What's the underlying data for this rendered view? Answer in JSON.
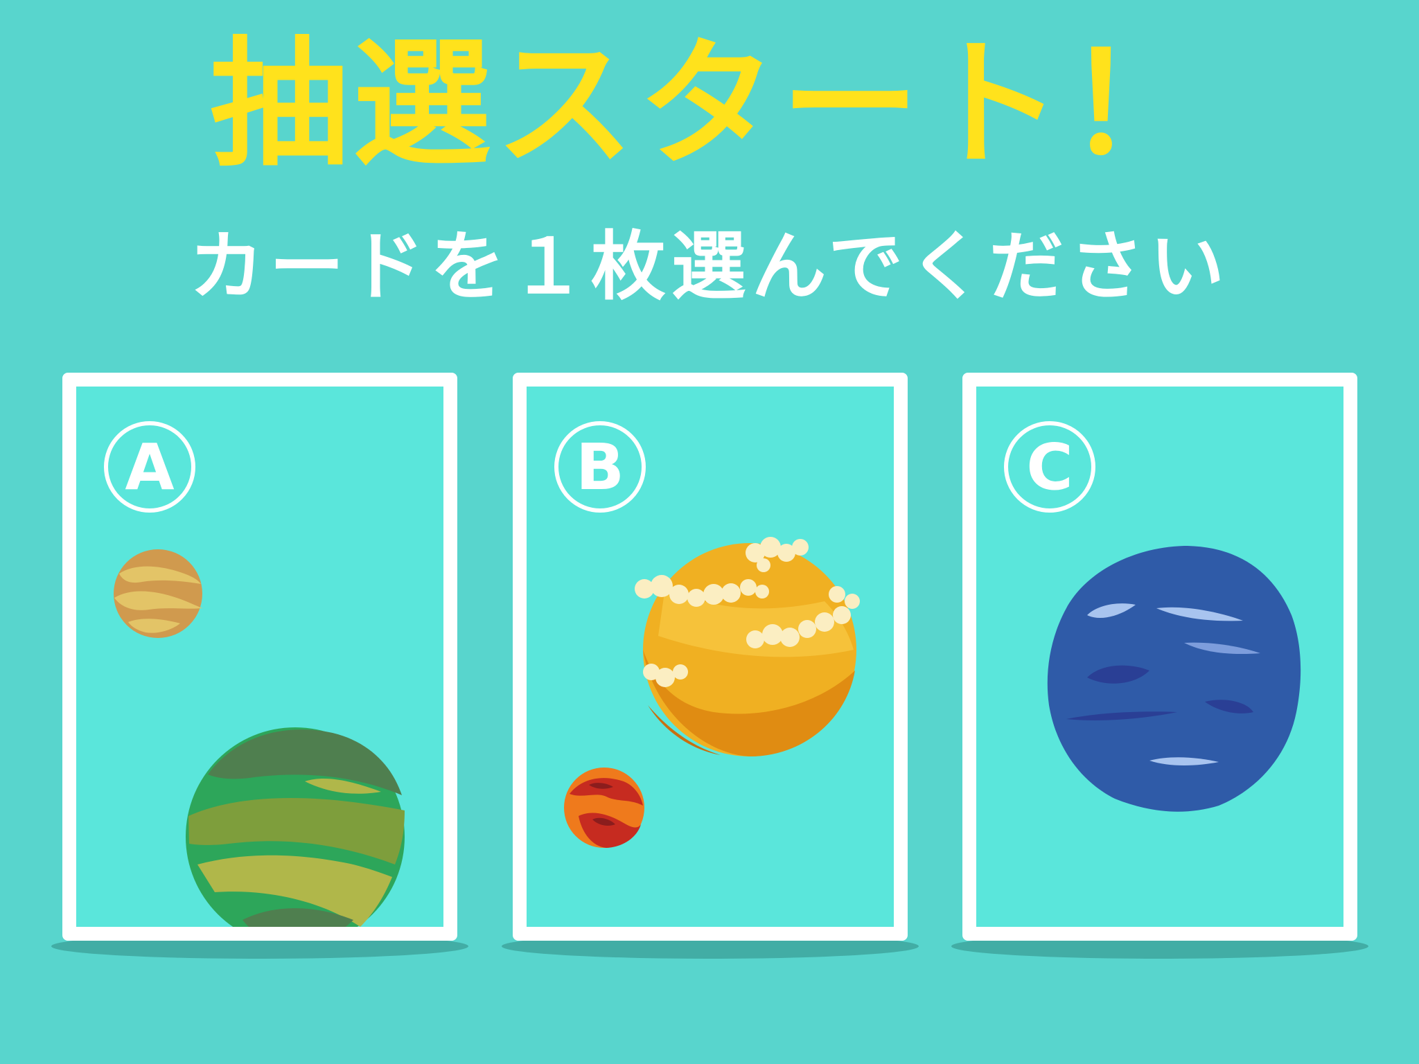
{
  "title": "抽選スタート！",
  "subtitle": "カードを１枚選んでください",
  "cards": [
    {
      "label": "A"
    },
    {
      "label": "B"
    },
    {
      "label": "C"
    }
  ],
  "colors": {
    "background": "#58d5cd",
    "card_fill": "#5ae6db",
    "card_border": "#ffffff",
    "title": "#ffe21c",
    "subtitle": "#ffffff"
  },
  "icons": {
    "card_a": [
      "small-tan-planet-icon",
      "green-striped-planet-icon"
    ],
    "card_b": [
      "yellow-cloudy-planet-icon",
      "red-lava-planet-icon"
    ],
    "card_c": [
      "blue-planet-icon"
    ]
  }
}
